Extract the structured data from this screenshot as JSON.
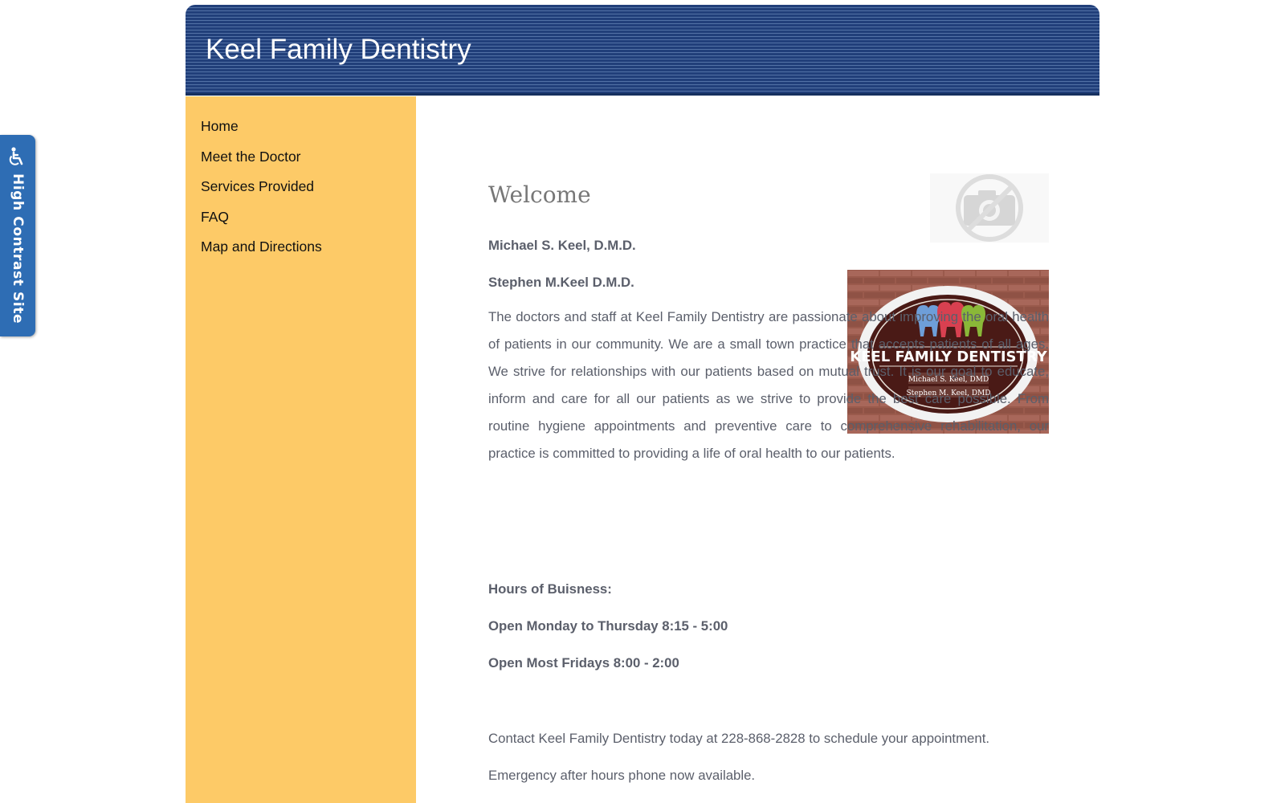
{
  "accessibility": {
    "label": "High Contrast Site",
    "icon": "wheelchair-icon"
  },
  "header": {
    "title": "Keel Family Dentistry"
  },
  "nav": {
    "items": [
      {
        "label": "Home"
      },
      {
        "label": "Meet the Doctor"
      },
      {
        "label": "Services Provided"
      },
      {
        "label": "FAQ"
      },
      {
        "label": "Map and Directions"
      }
    ]
  },
  "main": {
    "heading": "Welcome",
    "doctor1": "Michael S. Keel, D.M.D.",
    "doctor2": "Stephen M.Keel D.M.D.",
    "intro": "The doctors and staff at Keel Family Dentistry are passionate about improving the oral health of patients in our community. We are a small town practice that accepts patients of all ages. We strive for relationships with our patients based on mutual trust. It is our goal to educate, inform and care for all our patients as we strive to provide the best care possible. From routine hygiene appointments and preventive care to comprehensive rehabilitation, our practice is committed to providing a life of oral health to our patients.",
    "hours_title": "Hours of Buisness:",
    "hours_weekdays": "Open Monday to Thursday 8:15 - 5:00",
    "hours_fridays": "Open Most Fridays 8:00 - 2:00",
    "contact": "Contact Keel Family Dentistry today at 228-868-2828 to schedule your appointment.",
    "emergency": "Emergency after hours phone now available."
  },
  "sign": {
    "name": "KEEL FAMILY DENTISTRY",
    "line1": "Michael S. Keel, DMD",
    "line2": "Stephen M. Keel, DMD"
  },
  "colors": {
    "header_blue": "#213f7a",
    "sidebar_yellow": "#fdca67",
    "tab_blue": "#2e6db4",
    "body_text": "#5b5f6b"
  }
}
